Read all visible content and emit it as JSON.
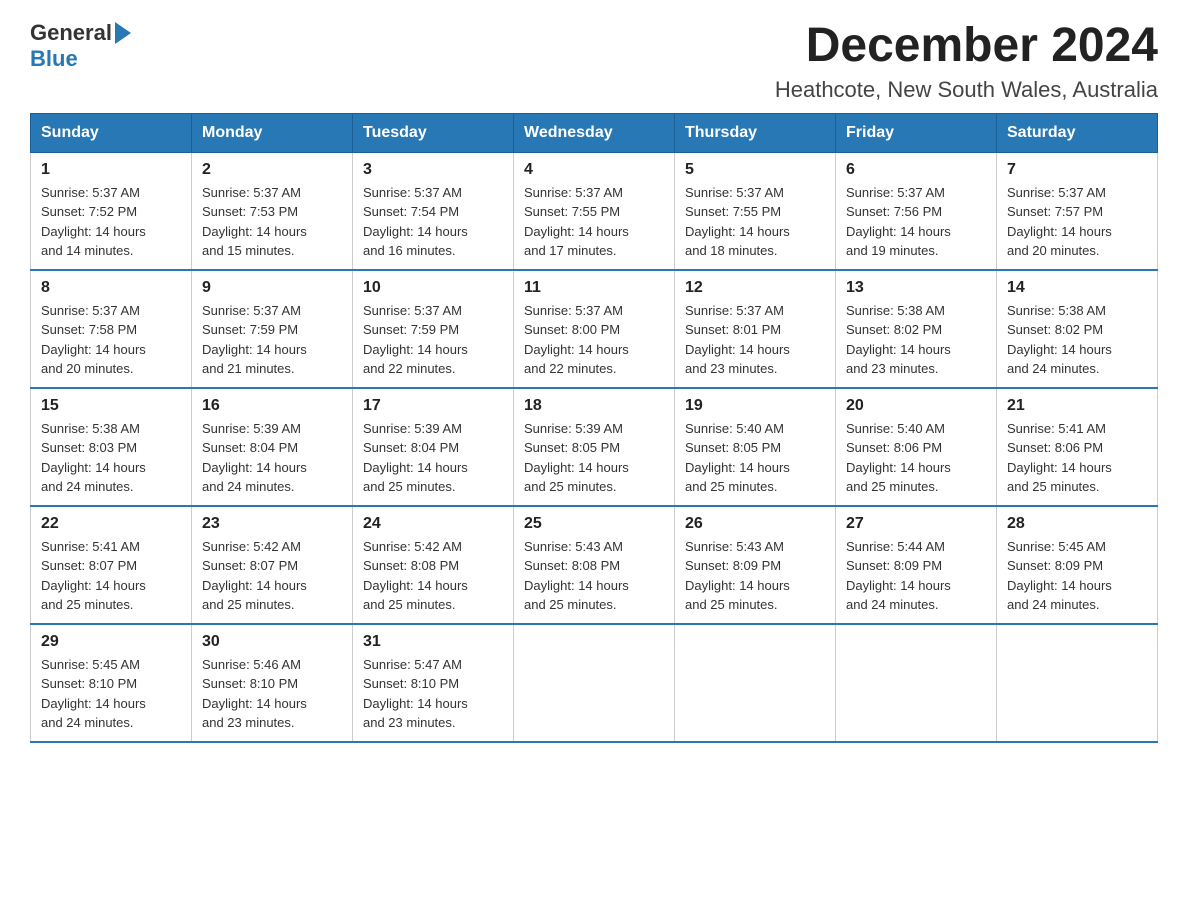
{
  "header": {
    "logo_general": "General",
    "logo_blue": "Blue",
    "main_title": "December 2024",
    "subtitle": "Heathcote, New South Wales, Australia"
  },
  "calendar": {
    "days_of_week": [
      "Sunday",
      "Monday",
      "Tuesday",
      "Wednesday",
      "Thursday",
      "Friday",
      "Saturday"
    ],
    "weeks": [
      [
        {
          "day": "1",
          "sunrise": "5:37 AM",
          "sunset": "7:52 PM",
          "daylight": "14 hours and 14 minutes."
        },
        {
          "day": "2",
          "sunrise": "5:37 AM",
          "sunset": "7:53 PM",
          "daylight": "14 hours and 15 minutes."
        },
        {
          "day": "3",
          "sunrise": "5:37 AM",
          "sunset": "7:54 PM",
          "daylight": "14 hours and 16 minutes."
        },
        {
          "day": "4",
          "sunrise": "5:37 AM",
          "sunset": "7:55 PM",
          "daylight": "14 hours and 17 minutes."
        },
        {
          "day": "5",
          "sunrise": "5:37 AM",
          "sunset": "7:55 PM",
          "daylight": "14 hours and 18 minutes."
        },
        {
          "day": "6",
          "sunrise": "5:37 AM",
          "sunset": "7:56 PM",
          "daylight": "14 hours and 19 minutes."
        },
        {
          "day": "7",
          "sunrise": "5:37 AM",
          "sunset": "7:57 PM",
          "daylight": "14 hours and 20 minutes."
        }
      ],
      [
        {
          "day": "8",
          "sunrise": "5:37 AM",
          "sunset": "7:58 PM",
          "daylight": "14 hours and 20 minutes."
        },
        {
          "day": "9",
          "sunrise": "5:37 AM",
          "sunset": "7:59 PM",
          "daylight": "14 hours and 21 minutes."
        },
        {
          "day": "10",
          "sunrise": "5:37 AM",
          "sunset": "7:59 PM",
          "daylight": "14 hours and 22 minutes."
        },
        {
          "day": "11",
          "sunrise": "5:37 AM",
          "sunset": "8:00 PM",
          "daylight": "14 hours and 22 minutes."
        },
        {
          "day": "12",
          "sunrise": "5:37 AM",
          "sunset": "8:01 PM",
          "daylight": "14 hours and 23 minutes."
        },
        {
          "day": "13",
          "sunrise": "5:38 AM",
          "sunset": "8:02 PM",
          "daylight": "14 hours and 23 minutes."
        },
        {
          "day": "14",
          "sunrise": "5:38 AM",
          "sunset": "8:02 PM",
          "daylight": "14 hours and 24 minutes."
        }
      ],
      [
        {
          "day": "15",
          "sunrise": "5:38 AM",
          "sunset": "8:03 PM",
          "daylight": "14 hours and 24 minutes."
        },
        {
          "day": "16",
          "sunrise": "5:39 AM",
          "sunset": "8:04 PM",
          "daylight": "14 hours and 24 minutes."
        },
        {
          "day": "17",
          "sunrise": "5:39 AM",
          "sunset": "8:04 PM",
          "daylight": "14 hours and 25 minutes."
        },
        {
          "day": "18",
          "sunrise": "5:39 AM",
          "sunset": "8:05 PM",
          "daylight": "14 hours and 25 minutes."
        },
        {
          "day": "19",
          "sunrise": "5:40 AM",
          "sunset": "8:05 PM",
          "daylight": "14 hours and 25 minutes."
        },
        {
          "day": "20",
          "sunrise": "5:40 AM",
          "sunset": "8:06 PM",
          "daylight": "14 hours and 25 minutes."
        },
        {
          "day": "21",
          "sunrise": "5:41 AM",
          "sunset": "8:06 PM",
          "daylight": "14 hours and 25 minutes."
        }
      ],
      [
        {
          "day": "22",
          "sunrise": "5:41 AM",
          "sunset": "8:07 PM",
          "daylight": "14 hours and 25 minutes."
        },
        {
          "day": "23",
          "sunrise": "5:42 AM",
          "sunset": "8:07 PM",
          "daylight": "14 hours and 25 minutes."
        },
        {
          "day": "24",
          "sunrise": "5:42 AM",
          "sunset": "8:08 PM",
          "daylight": "14 hours and 25 minutes."
        },
        {
          "day": "25",
          "sunrise": "5:43 AM",
          "sunset": "8:08 PM",
          "daylight": "14 hours and 25 minutes."
        },
        {
          "day": "26",
          "sunrise": "5:43 AM",
          "sunset": "8:09 PM",
          "daylight": "14 hours and 25 minutes."
        },
        {
          "day": "27",
          "sunrise": "5:44 AM",
          "sunset": "8:09 PM",
          "daylight": "14 hours and 24 minutes."
        },
        {
          "day": "28",
          "sunrise": "5:45 AM",
          "sunset": "8:09 PM",
          "daylight": "14 hours and 24 minutes."
        }
      ],
      [
        {
          "day": "29",
          "sunrise": "5:45 AM",
          "sunset": "8:10 PM",
          "daylight": "14 hours and 24 minutes."
        },
        {
          "day": "30",
          "sunrise": "5:46 AM",
          "sunset": "8:10 PM",
          "daylight": "14 hours and 23 minutes."
        },
        {
          "day": "31",
          "sunrise": "5:47 AM",
          "sunset": "8:10 PM",
          "daylight": "14 hours and 23 minutes."
        },
        null,
        null,
        null,
        null
      ]
    ],
    "labels": {
      "sunrise": "Sunrise:",
      "sunset": "Sunset:",
      "daylight": "Daylight:"
    }
  }
}
